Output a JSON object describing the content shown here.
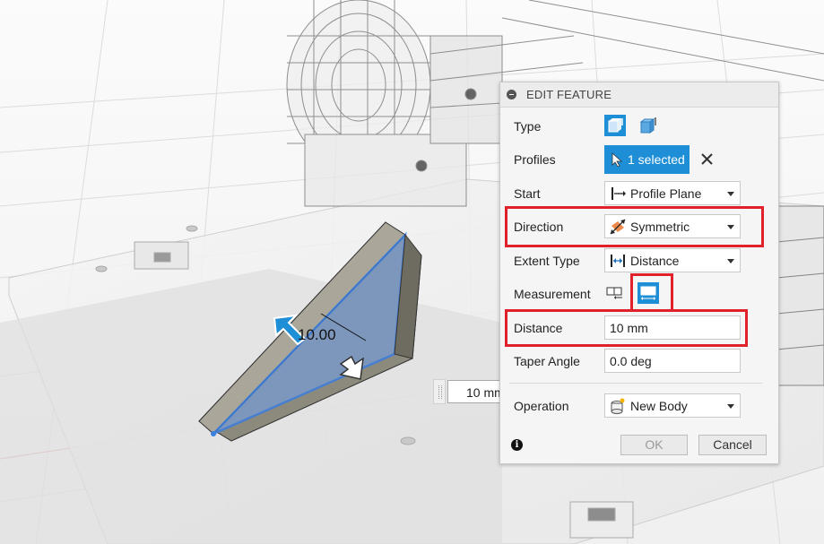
{
  "dialog": {
    "title": "EDIT FEATURE",
    "rows": {
      "type": {
        "label": "Type",
        "icons": [
          "extrude-solid-icon",
          "extrude-thin-icon"
        ]
      },
      "profiles": {
        "label": "Profiles",
        "value": "1 selected",
        "clear_icon": "close-icon"
      },
      "start": {
        "label": "Start",
        "value": "Profile Plane",
        "icon": "profile-plane-icon"
      },
      "direction": {
        "label": "Direction",
        "value": "Symmetric",
        "icon": "symmetric-icon"
      },
      "extent_type": {
        "label": "Extent Type",
        "value": "Distance",
        "icon": "distance-extent-icon"
      },
      "measurement": {
        "label": "Measurement",
        "icons": [
          "half-length-icon",
          "whole-length-icon"
        ],
        "selected": "whole-length-icon"
      },
      "distance": {
        "label": "Distance",
        "value": "10 mm"
      },
      "taper_angle": {
        "label": "Taper Angle",
        "value": "0.0 deg"
      },
      "operation": {
        "label": "Operation",
        "value": "New Body",
        "icon": "new-body-icon"
      }
    },
    "buttons": {
      "ok": "OK",
      "cancel": "Cancel"
    },
    "info_icon": "i"
  },
  "canvas": {
    "dimension_label": "10.00",
    "floating_input": "10 mm"
  },
  "colors": {
    "accent": "#1e8fd6",
    "highlight": "#e0202a",
    "dialog_bg": "#f5f5f5"
  }
}
